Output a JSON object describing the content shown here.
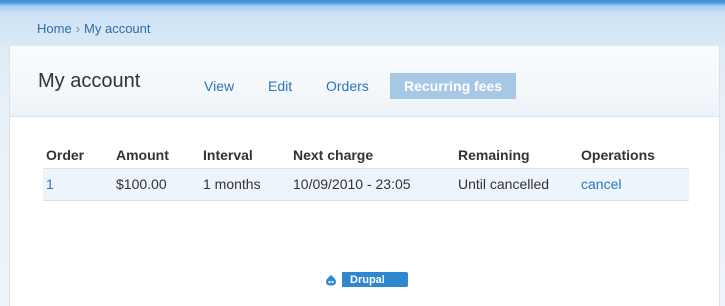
{
  "breadcrumb": {
    "items": [
      "Home",
      "My account"
    ],
    "separator": "›"
  },
  "page": {
    "title": "My account"
  },
  "tabs": [
    {
      "label": "View",
      "active": false
    },
    {
      "label": "Edit",
      "active": false
    },
    {
      "label": "Orders",
      "active": false
    },
    {
      "label": "Recurring fees",
      "active": true
    }
  ],
  "table": {
    "headers": [
      "Order",
      "Amount",
      "Interval",
      "Next charge",
      "Remaining",
      "Operations"
    ],
    "rows": [
      {
        "order": "1",
        "amount": "$100.00",
        "interval": "1 months",
        "next_charge": "10/09/2010 - 23:05",
        "remaining": "Until cancelled",
        "operation": "cancel"
      }
    ]
  },
  "footer": {
    "badge_label": "Drupal",
    "badge_icon": "drupal-drop-icon"
  },
  "colors": {
    "link": "#2a75bb",
    "active_tab_bg": "#a6c8e6",
    "header_blue": "#3d8fd6"
  }
}
